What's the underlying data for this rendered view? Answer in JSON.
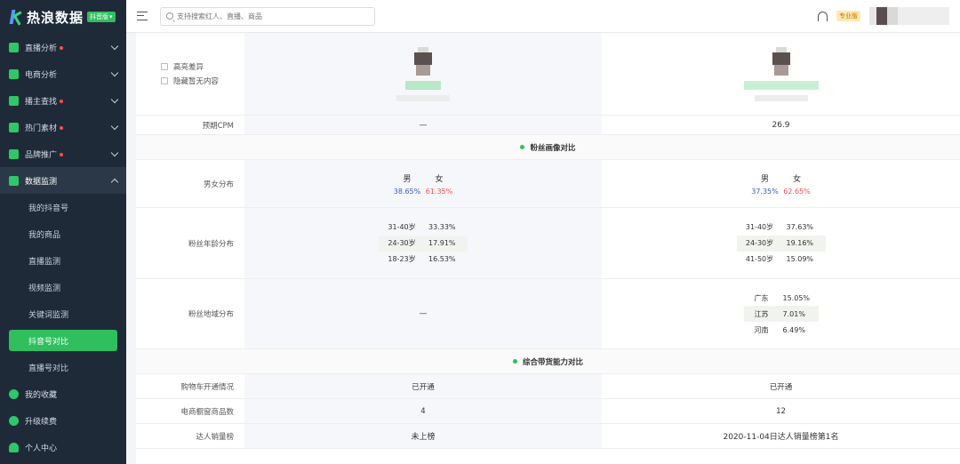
{
  "brand": {
    "title": "热浪数据",
    "badge": "抖音版"
  },
  "sidebar": {
    "items": [
      {
        "label": "直播分析",
        "dot": true
      },
      {
        "label": "电商分析",
        "dot": false
      },
      {
        "label": "播主查找",
        "dot": true
      },
      {
        "label": "热门素材",
        "dot": true
      },
      {
        "label": "品牌推广",
        "dot": true
      },
      {
        "label": "数据监测",
        "dot": false
      }
    ],
    "subitems": [
      "我的抖音号",
      "我的商品",
      "直播监测",
      "视频监测",
      "关键词监测",
      "抖音号对比",
      "直播号对比"
    ],
    "bottom": [
      "我的收藏",
      "升级续费",
      "个人中心"
    ]
  },
  "topbar": {
    "search_placeholder": "支持搜索红人、直播、商品",
    "pro_label": "专业版"
  },
  "compare": {
    "options": [
      "高亮差异",
      "隐藏暂无内容"
    ],
    "cpm": {
      "label": "预期CPM",
      "a": "—",
      "b": "26.9"
    },
    "section_fans": "粉丝画像对比",
    "gender": {
      "label": "男女分布",
      "male": "男",
      "female": "女",
      "a": {
        "male": "38.65%",
        "female": "61.35%"
      },
      "b": {
        "male": "37.35%",
        "female": "62.65%"
      }
    },
    "age": {
      "label": "粉丝年龄分布",
      "a": [
        [
          "31-40岁",
          "33.33%"
        ],
        [
          "24-30岁",
          "17.91%"
        ],
        [
          "18-23岁",
          "16.53%"
        ]
      ],
      "b": [
        [
          "31-40岁",
          "37.63%"
        ],
        [
          "24-30岁",
          "19.16%"
        ],
        [
          "41-50岁",
          "15.09%"
        ]
      ]
    },
    "region": {
      "label": "粉丝地域分布",
      "a": "—",
      "b": [
        [
          "广东",
          "15.05%"
        ],
        [
          "江苏",
          "7.01%"
        ],
        [
          "河南",
          "6.49%"
        ]
      ]
    },
    "section_sales": "综合带货能力对比",
    "cart": {
      "label": "购物车开通情况",
      "a": "已开通",
      "b": "已开通"
    },
    "window": {
      "label": "电商橱窗商品数",
      "a": "4",
      "b": "12"
    },
    "rank": {
      "label": "达人销量榜",
      "a": "未上榜",
      "b": "2020-11-04日达人销量榜第1名"
    }
  },
  "colors": {
    "accent": "#2fbf5f",
    "sidebar_bg": "#1f2a38",
    "male": "#3a5ccc",
    "female": "#ff4d4f"
  }
}
